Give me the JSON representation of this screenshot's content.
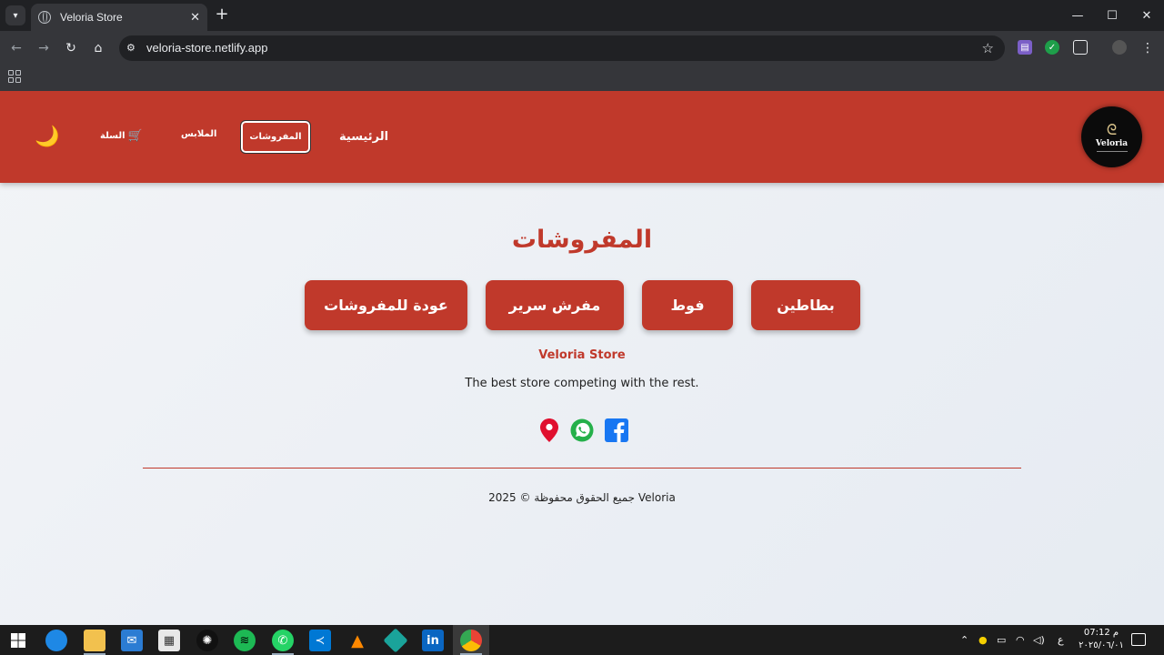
{
  "browser": {
    "tab_title": "Veloria Store",
    "tab_close": "✕",
    "new_tab": "+",
    "url": "veloria-store.netlify.app",
    "back": "←",
    "forward": "→",
    "reload": "↻",
    "home": "⌂",
    "star": "☆",
    "menu": "⋮",
    "minimize": "—",
    "maximize": "☐",
    "close": "✕"
  },
  "site": {
    "logo_text": "Veloria",
    "logo_mark": "ᘓ",
    "nav": {
      "home": "الرئيسية",
      "bedding": "المفروشات",
      "clothes": "الملابس",
      "cart": "السلة",
      "cart_icon": "🛒",
      "dark_mode_icon": "🌙"
    },
    "page_title": "المفروشات",
    "categories": {
      "blankets": "بطاطين",
      "towels": "فوط",
      "bed_sheets": "مفرش سرير",
      "back": "عودة للمفروشات"
    },
    "footer": {
      "brand": "Veloria Store",
      "tagline": "The best store competing with the rest.",
      "copyright": "جميع الحقوق محفوظة © 2025 Veloria"
    }
  },
  "taskbar": {
    "clock_time": "07:12 م",
    "clock_date": "٢٠٢٥/٠٦/٠١",
    "lang": "ع"
  },
  "colors": {
    "brand_red": "#c0392b",
    "header_text": "#ffffff",
    "page_bg": "#eef1f6"
  }
}
